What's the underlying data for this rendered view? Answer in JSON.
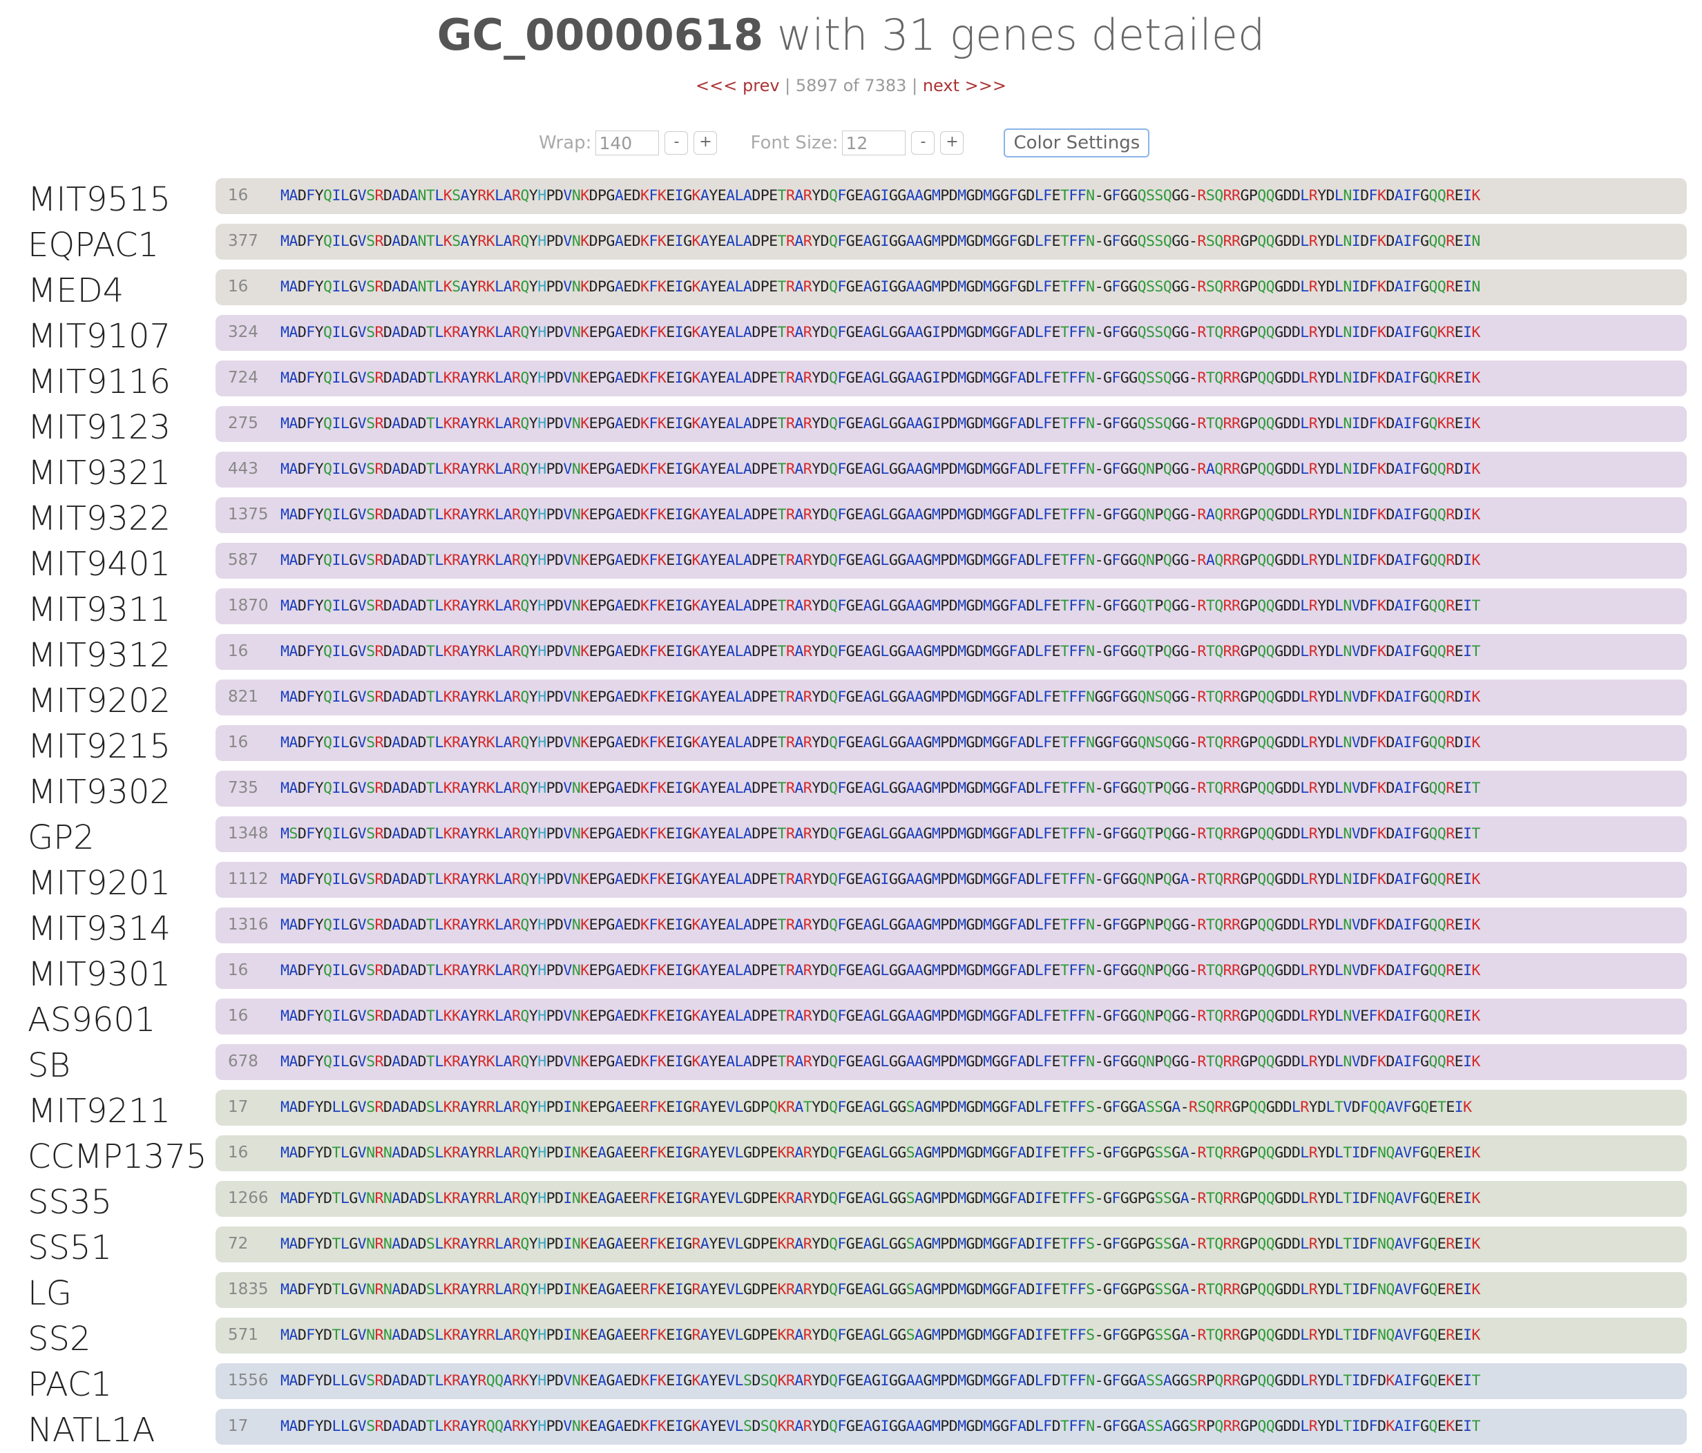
{
  "header": {
    "gc_id": "GC_00000618",
    "subtitle": "with 31 genes detailed"
  },
  "nav": {
    "prev": "<<< prev",
    "sep1": "|",
    "position": "5897 of 7383",
    "sep2": "|",
    "next": "next >>>"
  },
  "controls": {
    "wrap_label": "Wrap:",
    "wrap_value": "140",
    "font_size_label": "Font Size:",
    "font_size_value": "12",
    "minus": "-",
    "plus": "+",
    "color_settings": "Color Settings"
  },
  "colors": {
    "group_gray": "#e2dfdb",
    "group_purple": "#e3d8e9",
    "group_green": "#dde1d6",
    "group_blue": "#d8dee8",
    "residue_blue": "#1a3fbf",
    "residue_red": "#d42a2a",
    "residue_green": "#2f9a3a",
    "residue_cyan": "#33a6c2"
  },
  "genes": [
    {
      "name": "MIT9515",
      "num": "16",
      "group": "group_gray",
      "seq": "MADFYQILGVSRDADANTLKSAYRKLARQYHPDVNKDPGAEDKFKEIGKAYEALADPETRARYDQFGEAGIGGAAGMPDMGDMGGFGDLFETFFN-GFGGQSSQGG-RSQRRGPQQGDDLRYDLNIDFKDAIFGQQREIK"
    },
    {
      "name": "EQPAC1",
      "num": "377",
      "group": "group_gray",
      "seq": "MADFYQILGVSRDADANTLKSAYRKLARQYHPDVNKDPGAEDKFKEIGKAYEALADPETRARYDQFGEAGIGGAAGMPDMGDMGGFGDLFETFFN-GFGGQSSQGG-RSQRRGPQQGDDLRYDLNIDFKDAIFGQQREIN"
    },
    {
      "name": "MED4",
      "num": "16",
      "group": "group_gray",
      "seq": "MADFYQILGVSRDADANTLKSAYRKLARQYHPDVNKDPGAEDKFKEIGKAYEALADPETRARYDQFGEAGIGGAAGMPDMGDMGGFGDLFETFFN-GFGGQSSQGG-RSQRRGPQQGDDLRYDLNIDFKDAIFGQQREIN"
    },
    {
      "name": "MIT9107",
      "num": "324",
      "group": "group_purple",
      "seq": "MADFYQILGVSRDADADTLKRAYRKLARQYHPDVNKEPGAEDKFKEIGKAYEALADPETRARYDQFGEAGLGGAAGIPDMGDMGGFADLFETFFN-GFGGQSSQGG-RTQRRGPQQGDDLRYDLNIDFKDAIFGQKREIK"
    },
    {
      "name": "MIT9116",
      "num": "724",
      "group": "group_purple",
      "seq": "MADFYQILGVSRDADADTLKRAYRKLARQYHPDVNKEPGAEDKFKEIGKAYEALADPETRARYDQFGEAGLGGAAGIPDMGDMGGFADLFETFFN-GFGGQSSQGG-RTQRRGPQQGDDLRYDLNIDFKDAIFGQKREIK"
    },
    {
      "name": "MIT9123",
      "num": "275",
      "group": "group_purple",
      "seq": "MADFYQILGVSRDADADTLKRAYRKLARQYHPDVNKEPGAEDKFKEIGKAYEALADPETRARYDQFGEAGLGGAAGIPDMGDMGGFADLFETFFN-GFGGQSSQGG-RTQRRGPQQGDDLRYDLNIDFKDAIFGQKREIK"
    },
    {
      "name": "MIT9321",
      "num": "443",
      "group": "group_purple",
      "seq": "MADFYQILGVSRDADADTLKRAYRKLARQYHPDVNKEPGAEDKFKEIGKAYEALADPETRARYDQFGEAGLGGAAGMPDMGDMGGFADLFETFFN-GFGGQNPQGG-RAQRRGPQQGDDLRYDLNIDFKDAIFGQQRDIK"
    },
    {
      "name": "MIT9322",
      "num": "1375",
      "group": "group_purple",
      "seq": "MADFYQILGVSRDADADTLKRAYRKLARQYHPDVNKEPGAEDKFKEIGKAYEALADPETRARYDQFGEAGLGGAAGMPDMGDMGGFADLFETFFN-GFGGQNPQGG-RAQRRGPQQGDDLRYDLNIDFKDAIFGQQRDIK"
    },
    {
      "name": "MIT9401",
      "num": "587",
      "group": "group_purple",
      "seq": "MADFYQILGVSRDADADTLKRAYRKLARQYHPDVNKEPGAEDKFKEIGKAYEALADPETRARYDQFGEAGLGGAAGMPDMGDMGGFADLFETFFN-GFGGQNPQGG-RAQRRGPQQGDDLRYDLNIDFKDAIFGQQRDIK"
    },
    {
      "name": "MIT9311",
      "num": "1870",
      "group": "group_purple",
      "seq": "MADFYQILGVSRDADADTLKRAYRKLARQYHPDVNKEPGAEDKFKEIGKAYEALADPETRARYDQFGEAGLGGAAGMPDMGDMGGFADLFETFFN-GFGGQTPQGG-RTQRRGPQQGDDLRYDLNVDFKDAIFGQQREIT"
    },
    {
      "name": "MIT9312",
      "num": "16",
      "group": "group_purple",
      "seq": "MADFYQILGVSRDADADTLKRAYRKLARQYHPDVNKEPGAEDKFKEIGKAYEALADPETRARYDQFGEAGLGGAAGMPDMGDMGGFADLFETFFN-GFGGQTPQGG-RTQRRGPQQGDDLRYDLNVDFKDAIFGQQREIT"
    },
    {
      "name": "MIT9202",
      "num": "821",
      "group": "group_purple",
      "seq": "MADFYQILGVSRDADADTLKRAYRKLARQYHPDVNKEPGAEDKFKEIGKAYEALADPETRARYDQFGEAGLGGAAGMPDMGDMGGFADLFETFFNGGFGGQNSQGG-RTQRRGPQQGDDLRYDLNVDFKDAIFGQQRDIK"
    },
    {
      "name": "MIT9215",
      "num": "16",
      "group": "group_purple",
      "seq": "MADFYQILGVSRDADADTLKRAYRKLARQYHPDVNKEPGAEDKFKEIGKAYEALADPETRARYDQFGEAGLGGAAGMPDMGDMGGFADLFETFFNGGFGGQNSQGG-RTQRRGPQQGDDLRYDLNVDFKDAIFGQQRDIK"
    },
    {
      "name": "MIT9302",
      "num": "735",
      "group": "group_purple",
      "seq": "MADFYQILGVSRDADADTLKRAYRKLARQYHPDVNKEPGAEDKFKEIGKAYEALADPETRARYDQFGEAGLGGAAGMPDMGDMGGFADLFETFFN-GFGGQTPQGG-RTQRRGPQQGDDLRYDLNVDFKDAIFGQQREIT"
    },
    {
      "name": "GP2",
      "num": "1348",
      "group": "group_purple",
      "seq": "MSDFYQILGVSRDADADTLKRAYRKLARQYHPDVNKEPGAEDKFKEIGKAYEALADPETRARYDQFGEAGLGGAAGMPDMGDMGGFADLFETFFN-GFGGQTPQGG-RTQRRGPQQGDDLRYDLNVDFKDAIFGQQREIT"
    },
    {
      "name": "MIT9201",
      "num": "1112",
      "group": "group_purple",
      "seq": "MADFYQILGVSRDADADTLKRAYRKLARQYHPDVNKEPGAEDKFKEIGKAYEALADPETRARYDQFGEAGIGGAAGMPDMGDMGGFADLFETFFN-GFGGQNPQGA-RTQRRGPQQGDDLRYDLNIDFKDAIFGQQREIK"
    },
    {
      "name": "MIT9314",
      "num": "1316",
      "group": "group_purple",
      "seq": "MADFYQILGVSRDADADTLKRAYRKLARQYHPDVNKEPGAEDKFKEIGKAYEALADPETRARYDQFGEAGLGGAAGMPDMGDMGGFADLFETFFN-GFGGPNPQGG-RTQRRGPQQGDDLRYDLNVDFKDAIFGQQREIK"
    },
    {
      "name": "MIT9301",
      "num": "16",
      "group": "group_purple",
      "seq": "MADFYQILGVSRDADADTLKRAYRKLARQYHPDVNKEPGAEDKFKEIGKAYEALADPETRARYDQFGEAGLGGAAGMPDMGDMGGFADLFETFFN-GFGGQNPQGG-RTQRRGPQQGDDLRYDLNVDFKDAIFGQQREIK"
    },
    {
      "name": "AS9601",
      "num": "16",
      "group": "group_purple",
      "seq": "MADFYQILGVSRDADADTLKKAYRKLARQYHPDVNKEPGAEDKFKEIGKAYEALADPETRARYDQFGEAGLGGAAGMPDMGDMGGFADLFETFFN-GFGGQNPQGG-RTQRRGPQQGDDLRYDLNVEFKDAIFGQQREIK"
    },
    {
      "name": "SB",
      "num": "678",
      "group": "group_purple",
      "seq": "MADFYQILGVSRDADADTLKRAYRKLARQYHPDVNKEPGAEDKFKEIGKAYEALADPETRARYDQFGEAGLGGAAGMPDMGDMGGFADLFETFFN-GFGGQNPQGG-RTQRRGPQQGDDLRYDLNVDFKDAIFGQQREIK"
    },
    {
      "name": "MIT9211",
      "num": "17",
      "group": "group_green",
      "seq": "MADFYDLLGVSRDADADSLKRAYRRLARQYHPDINKEPGAEERFKEIGRAYEVLGDPQKRATYDQFGEAGLGGSAGMPDMGDMGGFADLFETFFS-GFGGASSGA-RSQRRGPQQGDDLRYDLTVDFQQAVFGQETEIK"
    },
    {
      "name": "CCMP1375",
      "num": "16",
      "group": "group_green",
      "seq": "MADFYDTLGVNRNADADSLKRAYRRLARQYHPDINKEAGAEERFKEIGRAYEVLGDPEKRARYDQFGEAGLGGSAGMPDMGDMGGFADIFETFFS-GFGGPGSSGA-RTQRRGPQQGDDLRYDLTIDFNQAVFGQEREIK"
    },
    {
      "name": "SS35",
      "num": "1266",
      "group": "group_green",
      "seq": "MADFYDTLGVNRNADADSLKRAYRRLARQYHPDINKEAGAEERFKEIGRAYEVLGDPEKRARYDQFGEAGLGGSAGMPDMGDMGGFADIFETFFS-GFGGPGSSGA-RTQRRGPQQGDDLRYDLTIDFNQAVFGQEREIK"
    },
    {
      "name": "SS51",
      "num": "72",
      "group": "group_green",
      "seq": "MADFYDTLGVNRNADADSLKRAYRRLARQYHPDINKEAGAEERFKEIGRAYEVLGDPEKRARYDQFGEAGLGGSAGMPDMGDMGGFADIFETFFS-GFGGPGSSGA-RTQRRGPQQGDDLRYDLTIDFNQAVFGQEREIK"
    },
    {
      "name": "LG",
      "num": "1835",
      "group": "group_green",
      "seq": "MADFYDTLGVNRNADADSLKRAYRRLARQYHPDINKEAGAEERFKEIGRAYEVLGDPEKRARYDQFGEAGLGGSAGMPDMGDMGGFADIFETFFS-GFGGPGSSGA-RTQRRGPQQGDDLRYDLTIDFNQAVFGQEREIK"
    },
    {
      "name": "SS2",
      "num": "571",
      "group": "group_green",
      "seq": "MADFYDTLGVNRNADADSLKRAYRRLARQYHPDINKEAGAEERFKEIGRAYEVLGDPEKRARYDQFGEAGLGGSAGMPDMGDMGGFADIFETFFS-GFGGPGSSGA-RTQRRGPQQGDDLRYDLTIDFNQAVFGQEREIK"
    },
    {
      "name": "PAC1",
      "num": "1556",
      "group": "group_blue",
      "seq": "MADFYDLLGVSRDADADTLKRAYRQQARKYHPDVNKEAGAEDKFKEIGKAYEVLSDSQKRARYDQFGEAGIGGAAGMPDMGDMGGFADLFDTFFN-GFGGASSAGGSRPQRRGPQQGDDLRYDLTIDFDKAIFGQEKEIT"
    },
    {
      "name": "NATL1A",
      "num": "17",
      "group": "group_blue",
      "seq": "MADFYDLLGVSRDADADTLKRAYRQQARKYHPDVNKEAGAEDKFKEIGKAYEVLSDSQKRARYDQFGEAGIGGAAGMPDMGDMGGFADLFDTFFN-GFGGASSAGGSRPQRRGPQQGDDLRYDLTIDFDKAIFGQEKEIT"
    }
  ]
}
